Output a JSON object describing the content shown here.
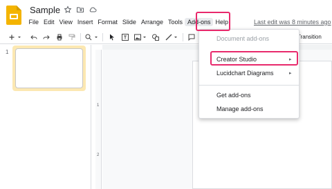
{
  "header": {
    "title": "Sample",
    "icons": [
      "star-icon",
      "move-to-folder-icon",
      "cloud-status-icon"
    ],
    "last_edit": "Last edit was 8 minutes ago"
  },
  "menu": [
    "File",
    "Edit",
    "View",
    "Insert",
    "Format",
    "Slide",
    "Arrange",
    "Tools",
    "Add-ons",
    "Help"
  ],
  "toolbar": {
    "transition_label": "Transition"
  },
  "filmstrip": {
    "slide_number": "1"
  },
  "ruler": {
    "mark_1": "1",
    "mark_2": "2"
  },
  "dropdown": {
    "document_addons": "Document add-ons",
    "creator_studio": "Creator Studio",
    "lucidchart": "Lucidchart Diagrams",
    "get_addons": "Get add-ons",
    "manage_addons": "Manage add-ons",
    "submenu_arrow": "▸"
  },
  "colors": {
    "highlight": "#e8286b",
    "logo": "#f4b400",
    "selected_slide": "#fce8b2"
  }
}
